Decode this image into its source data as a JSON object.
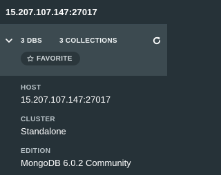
{
  "window": {
    "title": "15.207.107.147:27017"
  },
  "connection": {
    "dbs_label": "3 DBS",
    "collections_label": "3 COLLECTIONS",
    "favorite_label": "FAVORITE"
  },
  "details": {
    "host": {
      "label": "HOST",
      "value": "15.207.107.147:27017"
    },
    "cluster": {
      "label": "CLUSTER",
      "value": "Standalone"
    },
    "edition": {
      "label": "EDITION",
      "value": "MongoDB 6.0.2 Community"
    }
  },
  "icons": {
    "expand": "chevron-down-icon",
    "refresh": "refresh-icon",
    "favorite": "star-outline-icon"
  },
  "colors": {
    "sidebar_background": "#263238",
    "section_background": "#3c4a50",
    "favorite_pill": "#2b373c",
    "label_text": "#b8c2c7",
    "value_text": "#ffffff"
  }
}
